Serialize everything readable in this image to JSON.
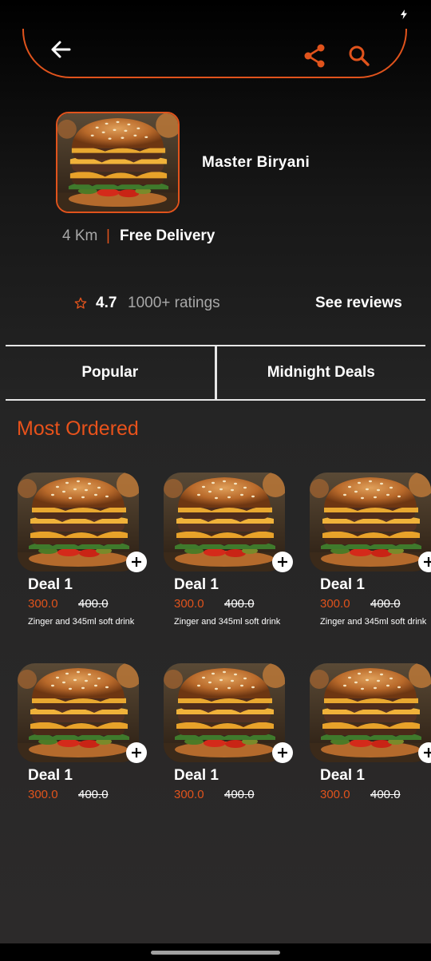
{
  "header": {
    "back_icon": "back-arrow-icon",
    "share_icon": "share-icon",
    "search_icon": "search-icon",
    "accent_color": "#e0531c"
  },
  "restaurant": {
    "image": "burger-photo",
    "name": "Master Biryani",
    "distance": "4 Km",
    "separator": "|",
    "delivery": "Free Delivery",
    "rating": "4.7",
    "rating_count": "1000+ ratings",
    "see_reviews": "See reviews"
  },
  "tabs": [
    {
      "label": "Popular"
    },
    {
      "label": "Midnight Deals"
    }
  ],
  "section": {
    "title": "Most Ordered"
  },
  "deals_row1": [
    {
      "title": "Deal 1",
      "price": "300.0",
      "old_price": "400.0",
      "description": "Zinger and 345ml soft drink"
    },
    {
      "title": "Deal 1",
      "price": "300.0",
      "old_price": "400.0",
      "description": "Zinger and 345ml soft drink"
    },
    {
      "title": "Deal 1",
      "price": "300.0",
      "old_price": "400.0",
      "description": "Zinger and 345ml soft drink"
    }
  ],
  "deals_row2": [
    {
      "title": "Deal 1",
      "price": "300.0",
      "old_price": "400.0"
    },
    {
      "title": "Deal 1",
      "price": "300.0",
      "old_price": "400.0"
    },
    {
      "title": "Deal 1",
      "price": "300.0",
      "old_price": "400.0"
    }
  ]
}
